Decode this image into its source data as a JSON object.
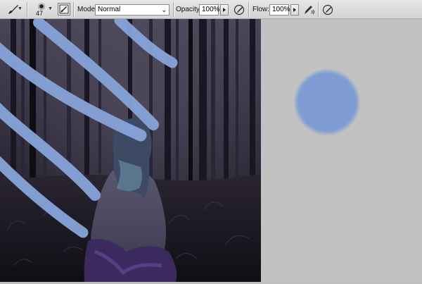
{
  "toolbar": {
    "tool_icon": "brush-icon",
    "brush_size": "47",
    "mode_label": "Mode:",
    "mode_value": "Normal",
    "opacity_label": "Opacity:",
    "opacity_value": "100%",
    "flow_label": "Flow:",
    "flow_value": "100%"
  },
  "colors": {
    "paint": "#86a3d8",
    "swatch": "#7f9cd3",
    "canvas_bg": "#c2c2c2",
    "forest_dark": "#1c1a28"
  }
}
